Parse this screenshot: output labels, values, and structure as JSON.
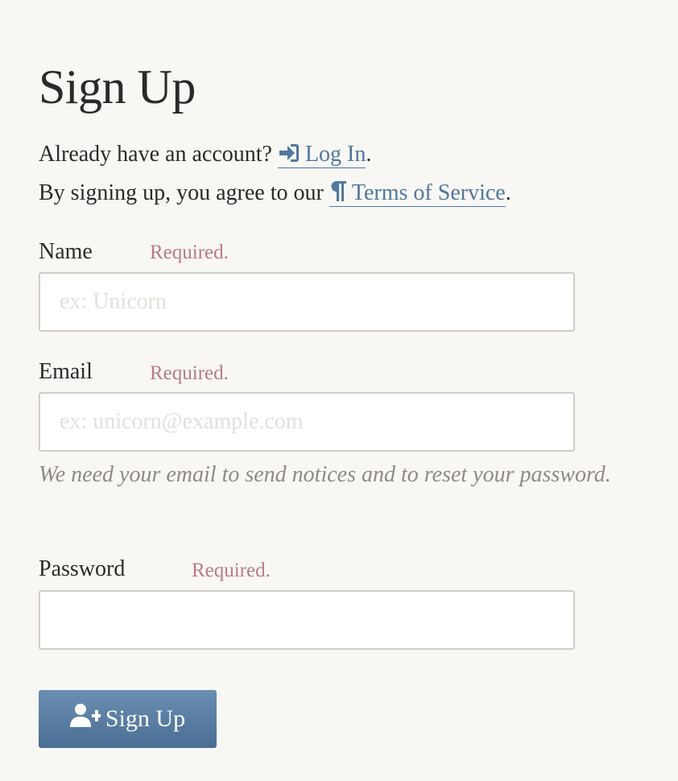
{
  "title": "Sign Up",
  "account_prompt": "Already have an account?",
  "login_link": "Log In",
  "agree_prompt": "By signing up, you agree to our",
  "terms_link": "Terms of Service",
  "period": ".",
  "required_text": "Required.",
  "fields": {
    "name": {
      "label": "Name",
      "placeholder": "ex: Unicorn",
      "value": ""
    },
    "email": {
      "label": "Email",
      "placeholder": "ex: unicorn@example.com",
      "value": "",
      "help": "We need your email to send notices and to reset your password."
    },
    "password": {
      "label": "Password",
      "placeholder": "",
      "value": ""
    }
  },
  "submit_label": "Sign Up",
  "icons": {
    "login": "sign-in-icon",
    "terms": "pilcrow-icon",
    "submit": "user-plus-icon"
  },
  "colors": {
    "link": "#4f789f",
    "required": "#b97a86",
    "help": "#8f8b80",
    "button": "#557aa0",
    "background": "#f8f7f4"
  }
}
